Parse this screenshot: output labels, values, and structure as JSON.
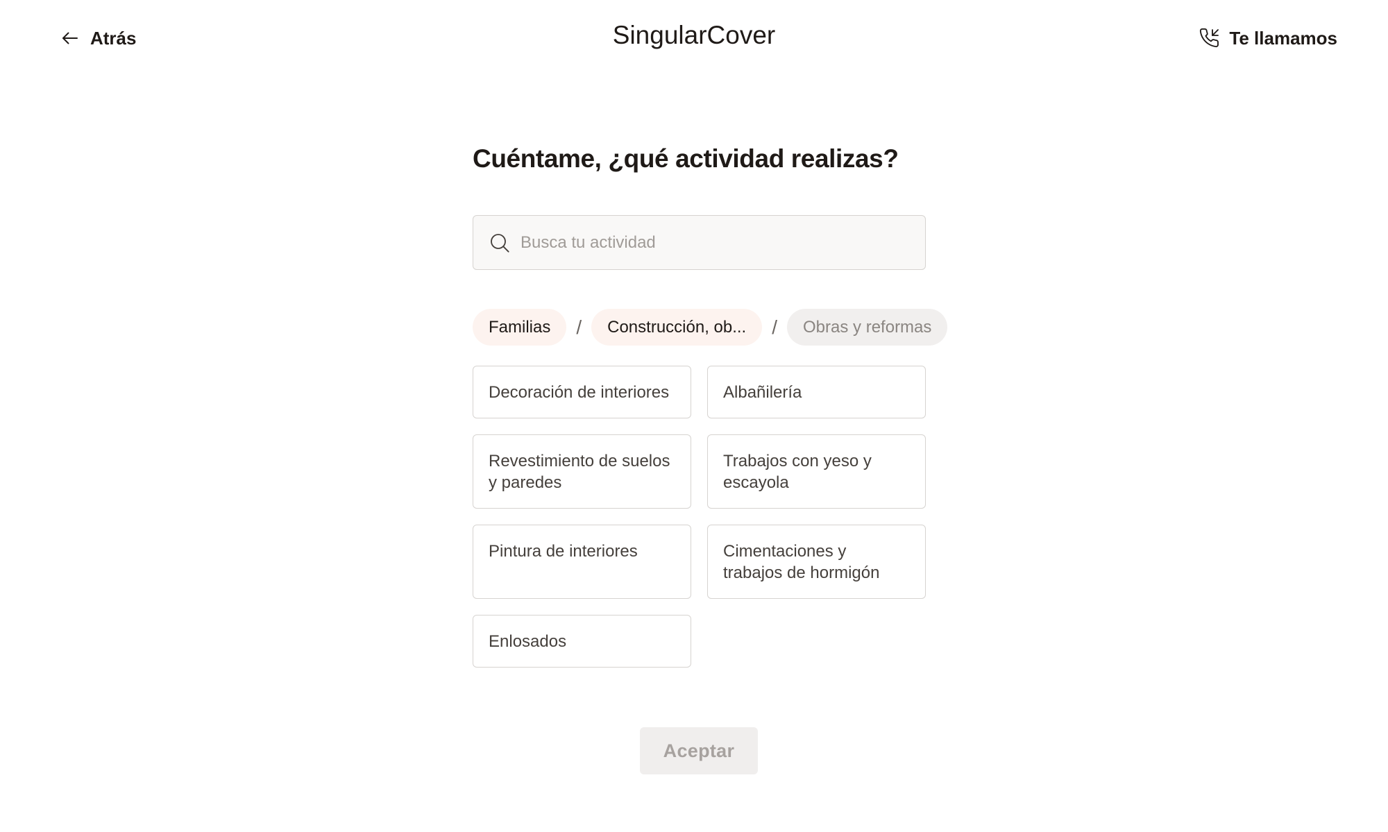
{
  "header": {
    "back_label": "Atrás",
    "brand": "SingularCover",
    "call_label": "Te llamamos"
  },
  "main": {
    "question": "Cuéntame, ¿qué actividad realizas?",
    "search": {
      "placeholder": "Busca tu actividad",
      "value": ""
    },
    "breadcrumb": [
      {
        "label": "Familias",
        "state": "done"
      },
      {
        "label": "Construcción, ob...",
        "state": "done"
      },
      {
        "label": "Obras y reformas",
        "state": "current"
      }
    ],
    "breadcrumb_separator": "/",
    "options": [
      "Decoración de interiores",
      "Albañilería",
      "Revestimiento de suelos y paredes",
      "Trabajos con yeso y escayola",
      "Pintura de interiores",
      "Cimentaciones y trabajos de hormigón",
      "Enlosados"
    ],
    "accept_label": "Aceptar"
  },
  "colors": {
    "text": "#1f1a17",
    "chip_done_bg": "#fdf3ef",
    "chip_current_bg": "#f1efee",
    "border": "#d6d3d0",
    "button_disabled_bg": "#f0eeed",
    "button_disabled_text": "#a7a29f"
  },
  "icons": [
    "arrow-left-icon",
    "phone-incoming-icon",
    "search-icon"
  ]
}
